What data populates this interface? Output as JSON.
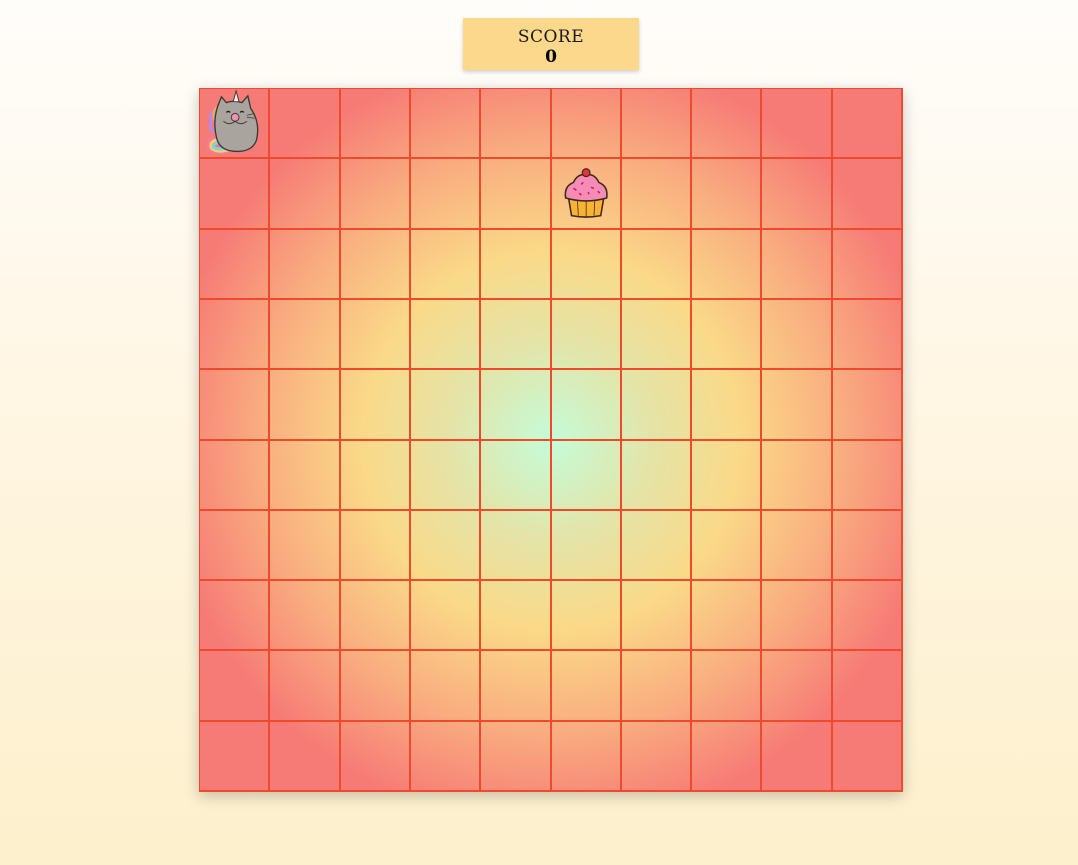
{
  "score": {
    "label": "SCORE",
    "value": "0"
  },
  "board": {
    "rows": 10,
    "columns": 10,
    "player": {
      "icon": "unicorn-cat-icon",
      "row": 0,
      "col": 0
    },
    "target": {
      "icon": "cupcake-icon",
      "row": 1,
      "col": 5
    }
  },
  "colors": {
    "grid_line": "#ef4a2b",
    "score_bg": "#fbd88b",
    "board_center": "#c4fcd8",
    "board_mid": "#fad988",
    "board_edge": "#f67b76"
  }
}
